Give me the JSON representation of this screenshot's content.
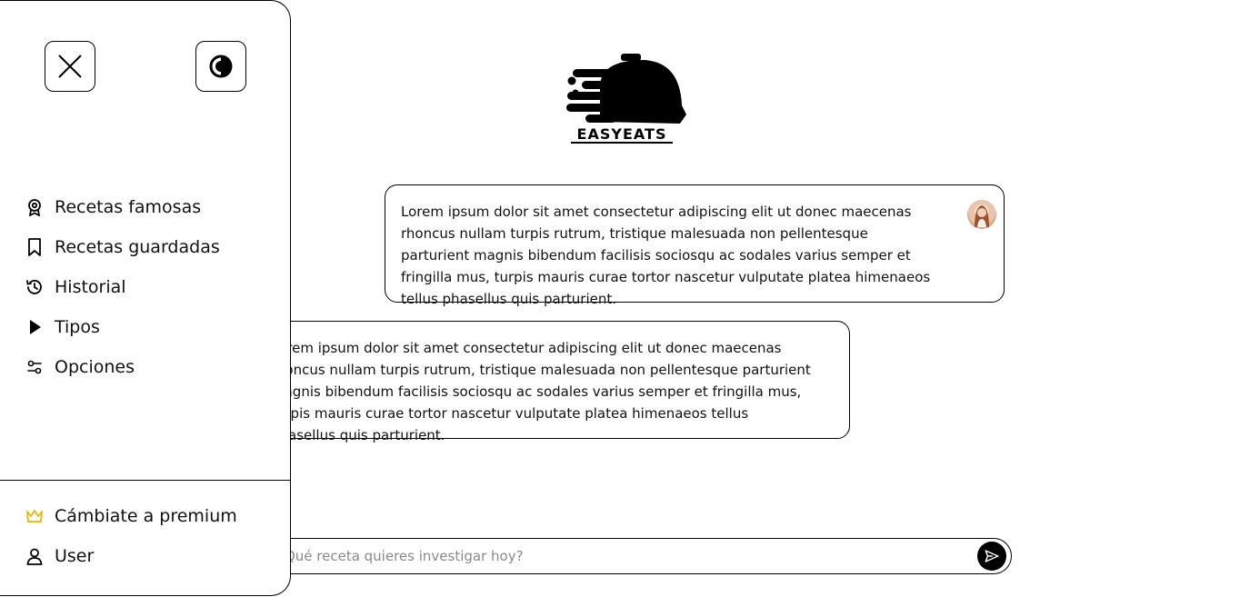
{
  "brand": {
    "name": "EASYEATS",
    "logo_icon": "food-cloche-logo"
  },
  "chat": {
    "messages": [
      {
        "role": "user",
        "text": "Lorem ipsum dolor sit amet consectetur adipiscing elit ut donec maecenas rhoncus nullam turpis rutrum, tristique malesuada non pellentesque parturient magnis bibendum facilisis sociosqu ac sodales varius semper et fringilla mus, turpis mauris curae tortor nascetur vulputate platea himenaeos tellus phasellus quis parturient."
      },
      {
        "role": "bot",
        "text": "Lorem ipsum dolor sit amet consectetur adipiscing elit ut donec maecenas rhoncus nullam turpis rutrum, tristique malesuada non pellentesque parturient magnis bibendum facilisis sociosqu ac sodales varius semper et fringilla mus, turpis mauris curae tortor nascetur vulputate platea himenaeos tellus phasellus quis parturient."
      }
    ]
  },
  "composer": {
    "placeholder": "¿Qué receta quieres investigar hoy?",
    "send_icon": "send-icon"
  },
  "sidebar": {
    "close_icon": "close-icon",
    "theme_icon": "contrast-icon",
    "items": [
      {
        "label": "Recetas famosas",
        "icon": "award-icon"
      },
      {
        "label": "Recetas guardadas",
        "icon": "bookmark-icon"
      },
      {
        "label": "Historial",
        "icon": "history-icon"
      },
      {
        "label": "Tipos",
        "icon": "play-icon"
      },
      {
        "label": "Opciones",
        "icon": "sliders-icon"
      }
    ],
    "bottom": [
      {
        "label": "Cámbiate a premium",
        "icon": "crown-icon"
      },
      {
        "label": "User",
        "icon": "user-icon"
      }
    ]
  },
  "colors": {
    "accent": "#000000",
    "premium": "#e8b800",
    "border": "#000000",
    "background": "#ffffff"
  }
}
